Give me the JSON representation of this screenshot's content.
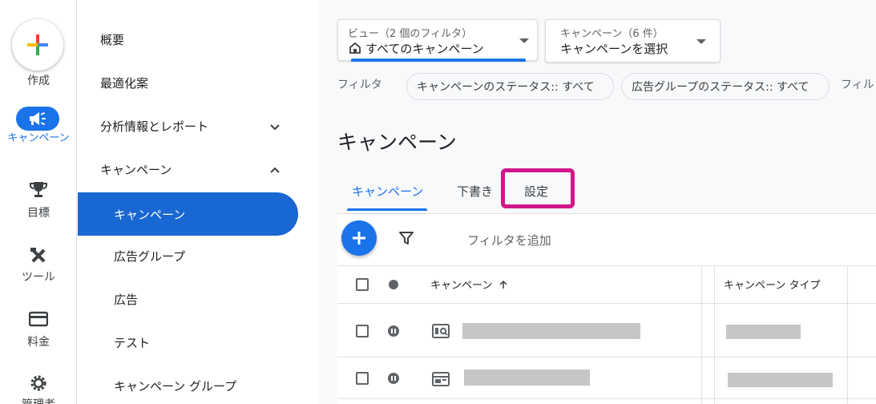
{
  "rail": {
    "create_label": "作成",
    "items": [
      {
        "label": "キャンペーン",
        "icon": "megaphone-icon"
      },
      {
        "label": "目標",
        "icon": "trophy-icon"
      },
      {
        "label": "ツール",
        "icon": "tools-icon"
      },
      {
        "label": "料金",
        "icon": "credit-card-icon"
      },
      {
        "label": "管理者",
        "icon": "gear-icon"
      }
    ]
  },
  "sidebar": {
    "items": [
      {
        "label": "概要"
      },
      {
        "label": "最適化案"
      },
      {
        "label": "分析情報とレポート"
      },
      {
        "label": "キャンペーン"
      },
      {
        "label": "キャンペーン"
      },
      {
        "label": "広告グループ"
      },
      {
        "label": "広告"
      },
      {
        "label": "テスト"
      },
      {
        "label": "キャンペーン グループ"
      }
    ]
  },
  "view_dropdown": {
    "small": "ビュー（2 個のフィルタ）",
    "value": "すべてのキャンペーン"
  },
  "campaign_dropdown": {
    "small": "キャンペーン（6 件）",
    "value": "キャンペーンを選択"
  },
  "filters": {
    "label": "フィルタ",
    "chips": [
      "キャンペーンのステータス:: すべて",
      "広告グループのステータス:: すべて",
      "フィル"
    ]
  },
  "page_title": "キャンペーン",
  "tabs": [
    {
      "label": "キャンペーン",
      "active": true
    },
    {
      "label": "下書き",
      "active": false
    },
    {
      "label": "設定",
      "active": false
    }
  ],
  "toolbar": {
    "add_filter": "フィルタを追加"
  },
  "table": {
    "columns": [
      "キャンペーン",
      "キャンペーン タイプ"
    ]
  },
  "colors": {
    "accent": "#1a73e8",
    "highlight": "#d3168a"
  }
}
